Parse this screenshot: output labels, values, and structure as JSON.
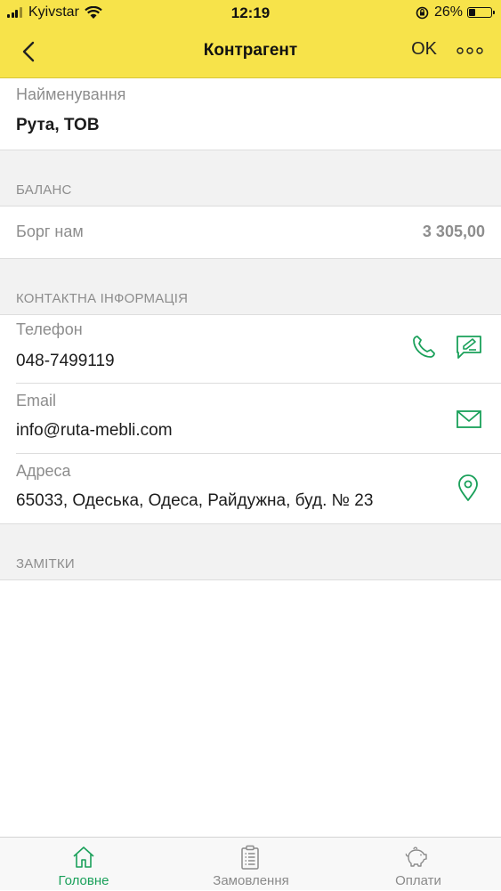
{
  "status_bar": {
    "carrier": "Kyivstar",
    "time": "12:19",
    "battery_percent": "26%",
    "battery_level": 0.26
  },
  "nav": {
    "title": "Контрагент",
    "ok_label": "OK"
  },
  "name_field": {
    "label": "Найменування",
    "value": "Рута, ТОВ"
  },
  "balance": {
    "header": "БАЛАНС",
    "debt_label": "Борг нам",
    "debt_value": "3 305,00"
  },
  "contacts": {
    "header": "КОНТАКТНА ІНФОРМАЦІЯ",
    "phone": {
      "label": "Телефон",
      "value": "048-7499119"
    },
    "email": {
      "label": "Email",
      "value": "info@ruta-mebli.com"
    },
    "address": {
      "label": "Адреса",
      "value": "65033, Одеська, Одеса, Райдужна, буд. № 23"
    }
  },
  "notes": {
    "header": "ЗАМІТКИ"
  },
  "tabs": [
    {
      "label": "Головне",
      "icon": "home-icon",
      "active": true
    },
    {
      "label": "Замовлення",
      "icon": "clipboard-icon",
      "active": false
    },
    {
      "label": "Оплати",
      "icon": "piggy-bank-icon",
      "active": false
    }
  ],
  "colors": {
    "accent_yellow": "#f7e34a",
    "accent_green": "#1aa05a",
    "section_gray": "#f2f2f2"
  }
}
